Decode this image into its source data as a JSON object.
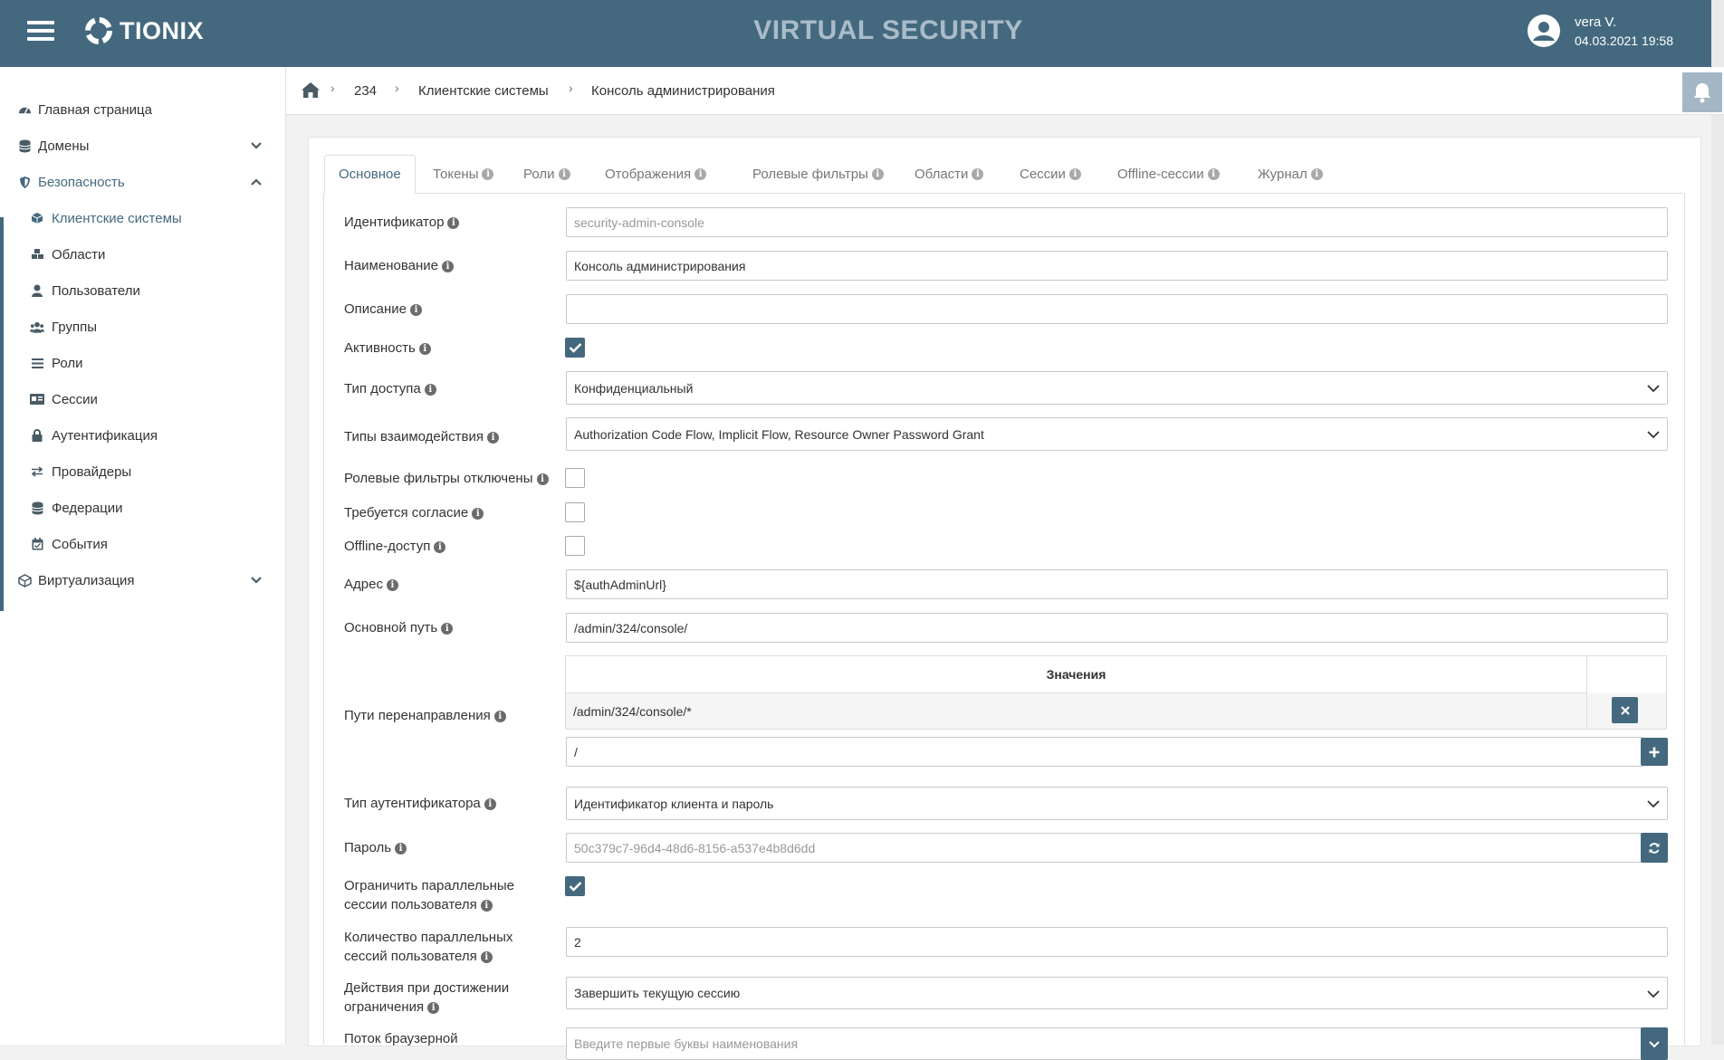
{
  "header": {
    "brand": "TIONIX",
    "app_title": "VIRTUAL SECURITY",
    "user_name": "vera V.",
    "user_datetime": "04.03.2021 19:58"
  },
  "sidebar": {
    "items": [
      {
        "label": "Главная страница",
        "icon": "dashboard-icon"
      },
      {
        "label": "Домены",
        "icon": "database-icon"
      },
      {
        "label": "Безопасность",
        "icon": "shield-icon"
      },
      {
        "label": "Клиентские системы",
        "icon": "cube-icon"
      },
      {
        "label": "Области",
        "icon": "cubes-icon"
      },
      {
        "label": "Пользователи",
        "icon": "user-icon"
      },
      {
        "label": "Группы",
        "icon": "users-icon"
      },
      {
        "label": "Роли",
        "icon": "list-icon"
      },
      {
        "label": "Сессии",
        "icon": "id-card-icon"
      },
      {
        "label": "Аутентификация",
        "icon": "lock-icon"
      },
      {
        "label": "Провайдеры",
        "icon": "exchange-icon"
      },
      {
        "label": "Федерации",
        "icon": "database-icon"
      },
      {
        "label": "События",
        "icon": "calendar-icon"
      },
      {
        "label": "Виртуализация",
        "icon": "virtualization-icon"
      }
    ]
  },
  "breadcrumb": [
    "234",
    "Клиентские системы",
    "Консоль администрирования"
  ],
  "tabs": [
    "Основное",
    "Токены",
    "Роли",
    "Отображения",
    "Ролевые фильтры",
    "Области",
    "Сессии",
    "Offline-сессии",
    "Журнал"
  ],
  "form": {
    "id_label": "Идентификатор",
    "id_value": "security-admin-console",
    "name_label": "Наименование",
    "name_value": "Консоль администрирования",
    "desc_label": "Описание",
    "desc_value": "",
    "active_label": "Активность",
    "active_checked": true,
    "access_type_label": "Тип доступа",
    "access_type_value": "Конфиденциальный",
    "flows_label": "Типы взаимодействия",
    "flows_value": "Authorization Code Flow, Implicit Flow, Resource Owner Password Grant",
    "role_filters_label": "Ролевые фильтры отключены",
    "consent_label": "Требуется согласие",
    "offline_label": "Offline-доступ",
    "address_label": "Адрес",
    "address_value": "${authAdminUrl}",
    "base_path_label": "Основной путь",
    "base_path_value": "/admin/324/console/",
    "redirect_label": "Пути перенаправления",
    "redirect_table_header": "Значения",
    "redirect_values": [
      "/admin/324/console/*"
    ],
    "redirect_new_value": "/",
    "auth_type_label": "Тип аутентификатора",
    "auth_type_value": "Идентификатор клиента и пароль",
    "password_label": "Пароль",
    "password_value": "50c379c7-96d4-48d6-8156-a537e4b8d6dd",
    "limit_sessions_label_1": "Ограничить параллельные",
    "limit_sessions_label_2": "сессии пользователя",
    "limit_sessions_checked": true,
    "session_count_label_1": "Количество параллельных",
    "session_count_label_2": "сессий пользователя",
    "session_count_value": "2",
    "limit_action_label_1": "Действия при достижении",
    "limit_action_label_2": "ограничения",
    "limit_action_value": "Завершить текущую сессию",
    "browser_flow_label_1": "Поток браузерной",
    "browser_flow_value": "Введите первые буквы наименования"
  },
  "colors": {
    "primary": "#44697f",
    "header_title": "#a9bcc8"
  }
}
